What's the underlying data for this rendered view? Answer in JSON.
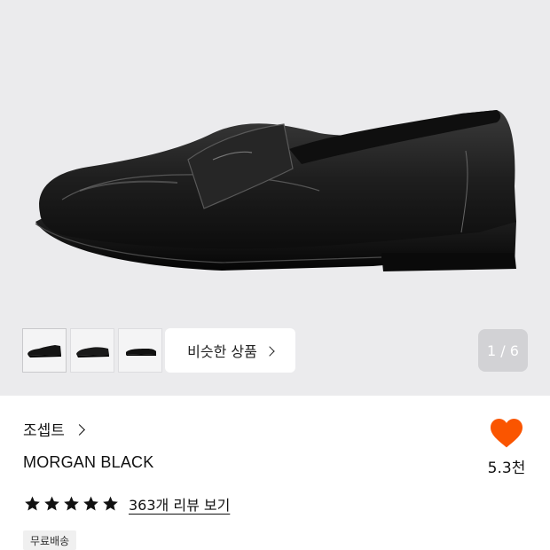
{
  "gallery": {
    "similar_label": "비슷한 상품",
    "pager": "1 / 6",
    "thumbnails": [
      "shoe-thumbnail",
      "shoe-thumbnail",
      "shoe-thumbnail"
    ]
  },
  "product": {
    "brand": "조셉트",
    "name": "MORGAN BLACK",
    "rating_stars": 5,
    "review_link": "363개 리뷰 보기",
    "tag": "무료배송"
  },
  "like": {
    "count": "5.3천",
    "color": "#fa5500"
  },
  "colors": {
    "hero_bg": "#ebebed",
    "pager_bg": "#d2d2d5"
  }
}
